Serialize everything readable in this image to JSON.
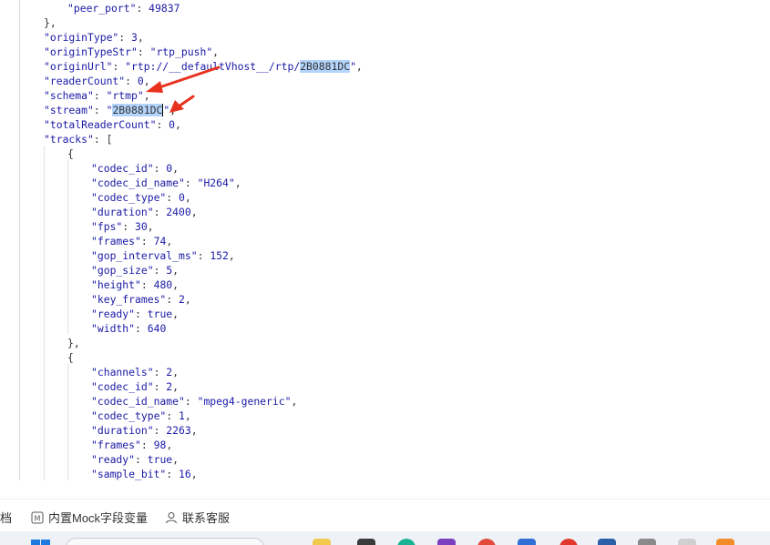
{
  "json_lines": [
    {
      "indent": 2,
      "parts": [
        [
          "k",
          "\"peer_port\""
        ],
        [
          "p",
          ": "
        ],
        [
          "n",
          "49837"
        ]
      ]
    },
    {
      "indent": 1,
      "parts": [
        [
          "p",
          "},"
        ]
      ]
    },
    {
      "indent": 1,
      "parts": [
        [
          "k",
          "\"originType\""
        ],
        [
          "p",
          ": "
        ],
        [
          "n",
          "3"
        ],
        [
          "p",
          ","
        ]
      ]
    },
    {
      "indent": 1,
      "parts": [
        [
          "k",
          "\"originTypeStr\""
        ],
        [
          "p",
          ": "
        ],
        [
          "s",
          "\"rtp_push\""
        ],
        [
          "p",
          ","
        ]
      ]
    },
    {
      "indent": 1,
      "parts": [
        [
          "k",
          "\"originUrl\""
        ],
        [
          "p",
          ": "
        ],
        [
          "s",
          "\"rtp://__defaultVhost__/rtp/"
        ],
        [
          "sel",
          "2B0881DC"
        ],
        [
          "s",
          "\""
        ],
        [
          "p",
          ","
        ]
      ]
    },
    {
      "indent": 1,
      "parts": [
        [
          "k",
          "\"readerCount\""
        ],
        [
          "p",
          ": "
        ],
        [
          "n",
          "0"
        ],
        [
          "p",
          ","
        ]
      ]
    },
    {
      "indent": 1,
      "parts": [
        [
          "k",
          "\"schema\""
        ],
        [
          "p",
          ": "
        ],
        [
          "s",
          "\"rtmp\""
        ],
        [
          "p",
          ","
        ]
      ]
    },
    {
      "indent": 1,
      "parts": [
        [
          "k",
          "\"stream\""
        ],
        [
          "p",
          ": "
        ],
        [
          "s",
          "\""
        ],
        [
          "sel",
          "2B0881DC"
        ],
        [
          "caret",
          ""
        ],
        [
          "s",
          "\""
        ],
        [
          "p",
          ","
        ]
      ]
    },
    {
      "indent": 1,
      "parts": [
        [
          "k",
          "\"totalReaderCount\""
        ],
        [
          "p",
          ": "
        ],
        [
          "n",
          "0"
        ],
        [
          "p",
          ","
        ]
      ]
    },
    {
      "indent": 1,
      "parts": [
        [
          "k",
          "\"tracks\""
        ],
        [
          "p",
          ": ["
        ]
      ]
    },
    {
      "indent": 2,
      "parts": [
        [
          "p",
          "{"
        ]
      ]
    },
    {
      "indent": 3,
      "parts": [
        [
          "k",
          "\"codec_id\""
        ],
        [
          "p",
          ": "
        ],
        [
          "n",
          "0"
        ],
        [
          "p",
          ","
        ]
      ]
    },
    {
      "indent": 3,
      "parts": [
        [
          "k",
          "\"codec_id_name\""
        ],
        [
          "p",
          ": "
        ],
        [
          "s",
          "\"H264\""
        ],
        [
          "p",
          ","
        ]
      ]
    },
    {
      "indent": 3,
      "parts": [
        [
          "k",
          "\"codec_type\""
        ],
        [
          "p",
          ": "
        ],
        [
          "n",
          "0"
        ],
        [
          "p",
          ","
        ]
      ]
    },
    {
      "indent": 3,
      "parts": [
        [
          "k",
          "\"duration\""
        ],
        [
          "p",
          ": "
        ],
        [
          "n",
          "2400"
        ],
        [
          "p",
          ","
        ]
      ]
    },
    {
      "indent": 3,
      "parts": [
        [
          "k",
          "\"fps\""
        ],
        [
          "p",
          ": "
        ],
        [
          "n",
          "30"
        ],
        [
          "p",
          ","
        ]
      ]
    },
    {
      "indent": 3,
      "parts": [
        [
          "k",
          "\"frames\""
        ],
        [
          "p",
          ": "
        ],
        [
          "n",
          "74"
        ],
        [
          "p",
          ","
        ]
      ]
    },
    {
      "indent": 3,
      "parts": [
        [
          "k",
          "\"gop_interval_ms\""
        ],
        [
          "p",
          ": "
        ],
        [
          "n",
          "152"
        ],
        [
          "p",
          ","
        ]
      ]
    },
    {
      "indent": 3,
      "parts": [
        [
          "k",
          "\"gop_size\""
        ],
        [
          "p",
          ": "
        ],
        [
          "n",
          "5"
        ],
        [
          "p",
          ","
        ]
      ]
    },
    {
      "indent": 3,
      "parts": [
        [
          "k",
          "\"height\""
        ],
        [
          "p",
          ": "
        ],
        [
          "n",
          "480"
        ],
        [
          "p",
          ","
        ]
      ]
    },
    {
      "indent": 3,
      "parts": [
        [
          "k",
          "\"key_frames\""
        ],
        [
          "p",
          ": "
        ],
        [
          "n",
          "2"
        ],
        [
          "p",
          ","
        ]
      ]
    },
    {
      "indent": 3,
      "parts": [
        [
          "k",
          "\"ready\""
        ],
        [
          "p",
          ": "
        ],
        [
          "n",
          "true"
        ],
        [
          "p",
          ","
        ]
      ]
    },
    {
      "indent": 3,
      "parts": [
        [
          "k",
          "\"width\""
        ],
        [
          "p",
          ": "
        ],
        [
          "n",
          "640"
        ]
      ]
    },
    {
      "indent": 2,
      "parts": [
        [
          "p",
          "},"
        ]
      ]
    },
    {
      "indent": 2,
      "parts": [
        [
          "p",
          "{"
        ]
      ]
    },
    {
      "indent": 3,
      "parts": [
        [
          "k",
          "\"channels\""
        ],
        [
          "p",
          ": "
        ],
        [
          "n",
          "2"
        ],
        [
          "p",
          ","
        ]
      ]
    },
    {
      "indent": 3,
      "parts": [
        [
          "k",
          "\"codec_id\""
        ],
        [
          "p",
          ": "
        ],
        [
          "n",
          "2"
        ],
        [
          "p",
          ","
        ]
      ]
    },
    {
      "indent": 3,
      "parts": [
        [
          "k",
          "\"codec_id_name\""
        ],
        [
          "p",
          ": "
        ],
        [
          "s",
          "\"mpeg4-generic\""
        ],
        [
          "p",
          ","
        ]
      ]
    },
    {
      "indent": 3,
      "parts": [
        [
          "k",
          "\"codec_type\""
        ],
        [
          "p",
          ": "
        ],
        [
          "n",
          "1"
        ],
        [
          "p",
          ","
        ]
      ]
    },
    {
      "indent": 3,
      "parts": [
        [
          "k",
          "\"duration\""
        ],
        [
          "p",
          ": "
        ],
        [
          "n",
          "2263"
        ],
        [
          "p",
          ","
        ]
      ]
    },
    {
      "indent": 3,
      "parts": [
        [
          "k",
          "\"frames\""
        ],
        [
          "p",
          ": "
        ],
        [
          "n",
          "98"
        ],
        [
          "p",
          ","
        ]
      ]
    },
    {
      "indent": 3,
      "parts": [
        [
          "k",
          "\"ready\""
        ],
        [
          "p",
          ": "
        ],
        [
          "n",
          "true"
        ],
        [
          "p",
          ","
        ]
      ]
    },
    {
      "indent": 3,
      "parts": [
        [
          "k",
          "\"sample_bit\""
        ],
        [
          "p",
          ": "
        ],
        [
          "n",
          "16"
        ],
        [
          "p",
          ","
        ]
      ]
    }
  ],
  "bottom_bar": {
    "docs_label": "档",
    "mock_label": "内置Mock字段变量",
    "contact_label": "联系客服"
  },
  "colors": {
    "key": "#1a1aa6",
    "selection": "#b3d4fc",
    "arrow": "#e8321e"
  },
  "icons": [
    "mock-icon",
    "person-icon",
    "windows-start-icon",
    "search-icon"
  ]
}
